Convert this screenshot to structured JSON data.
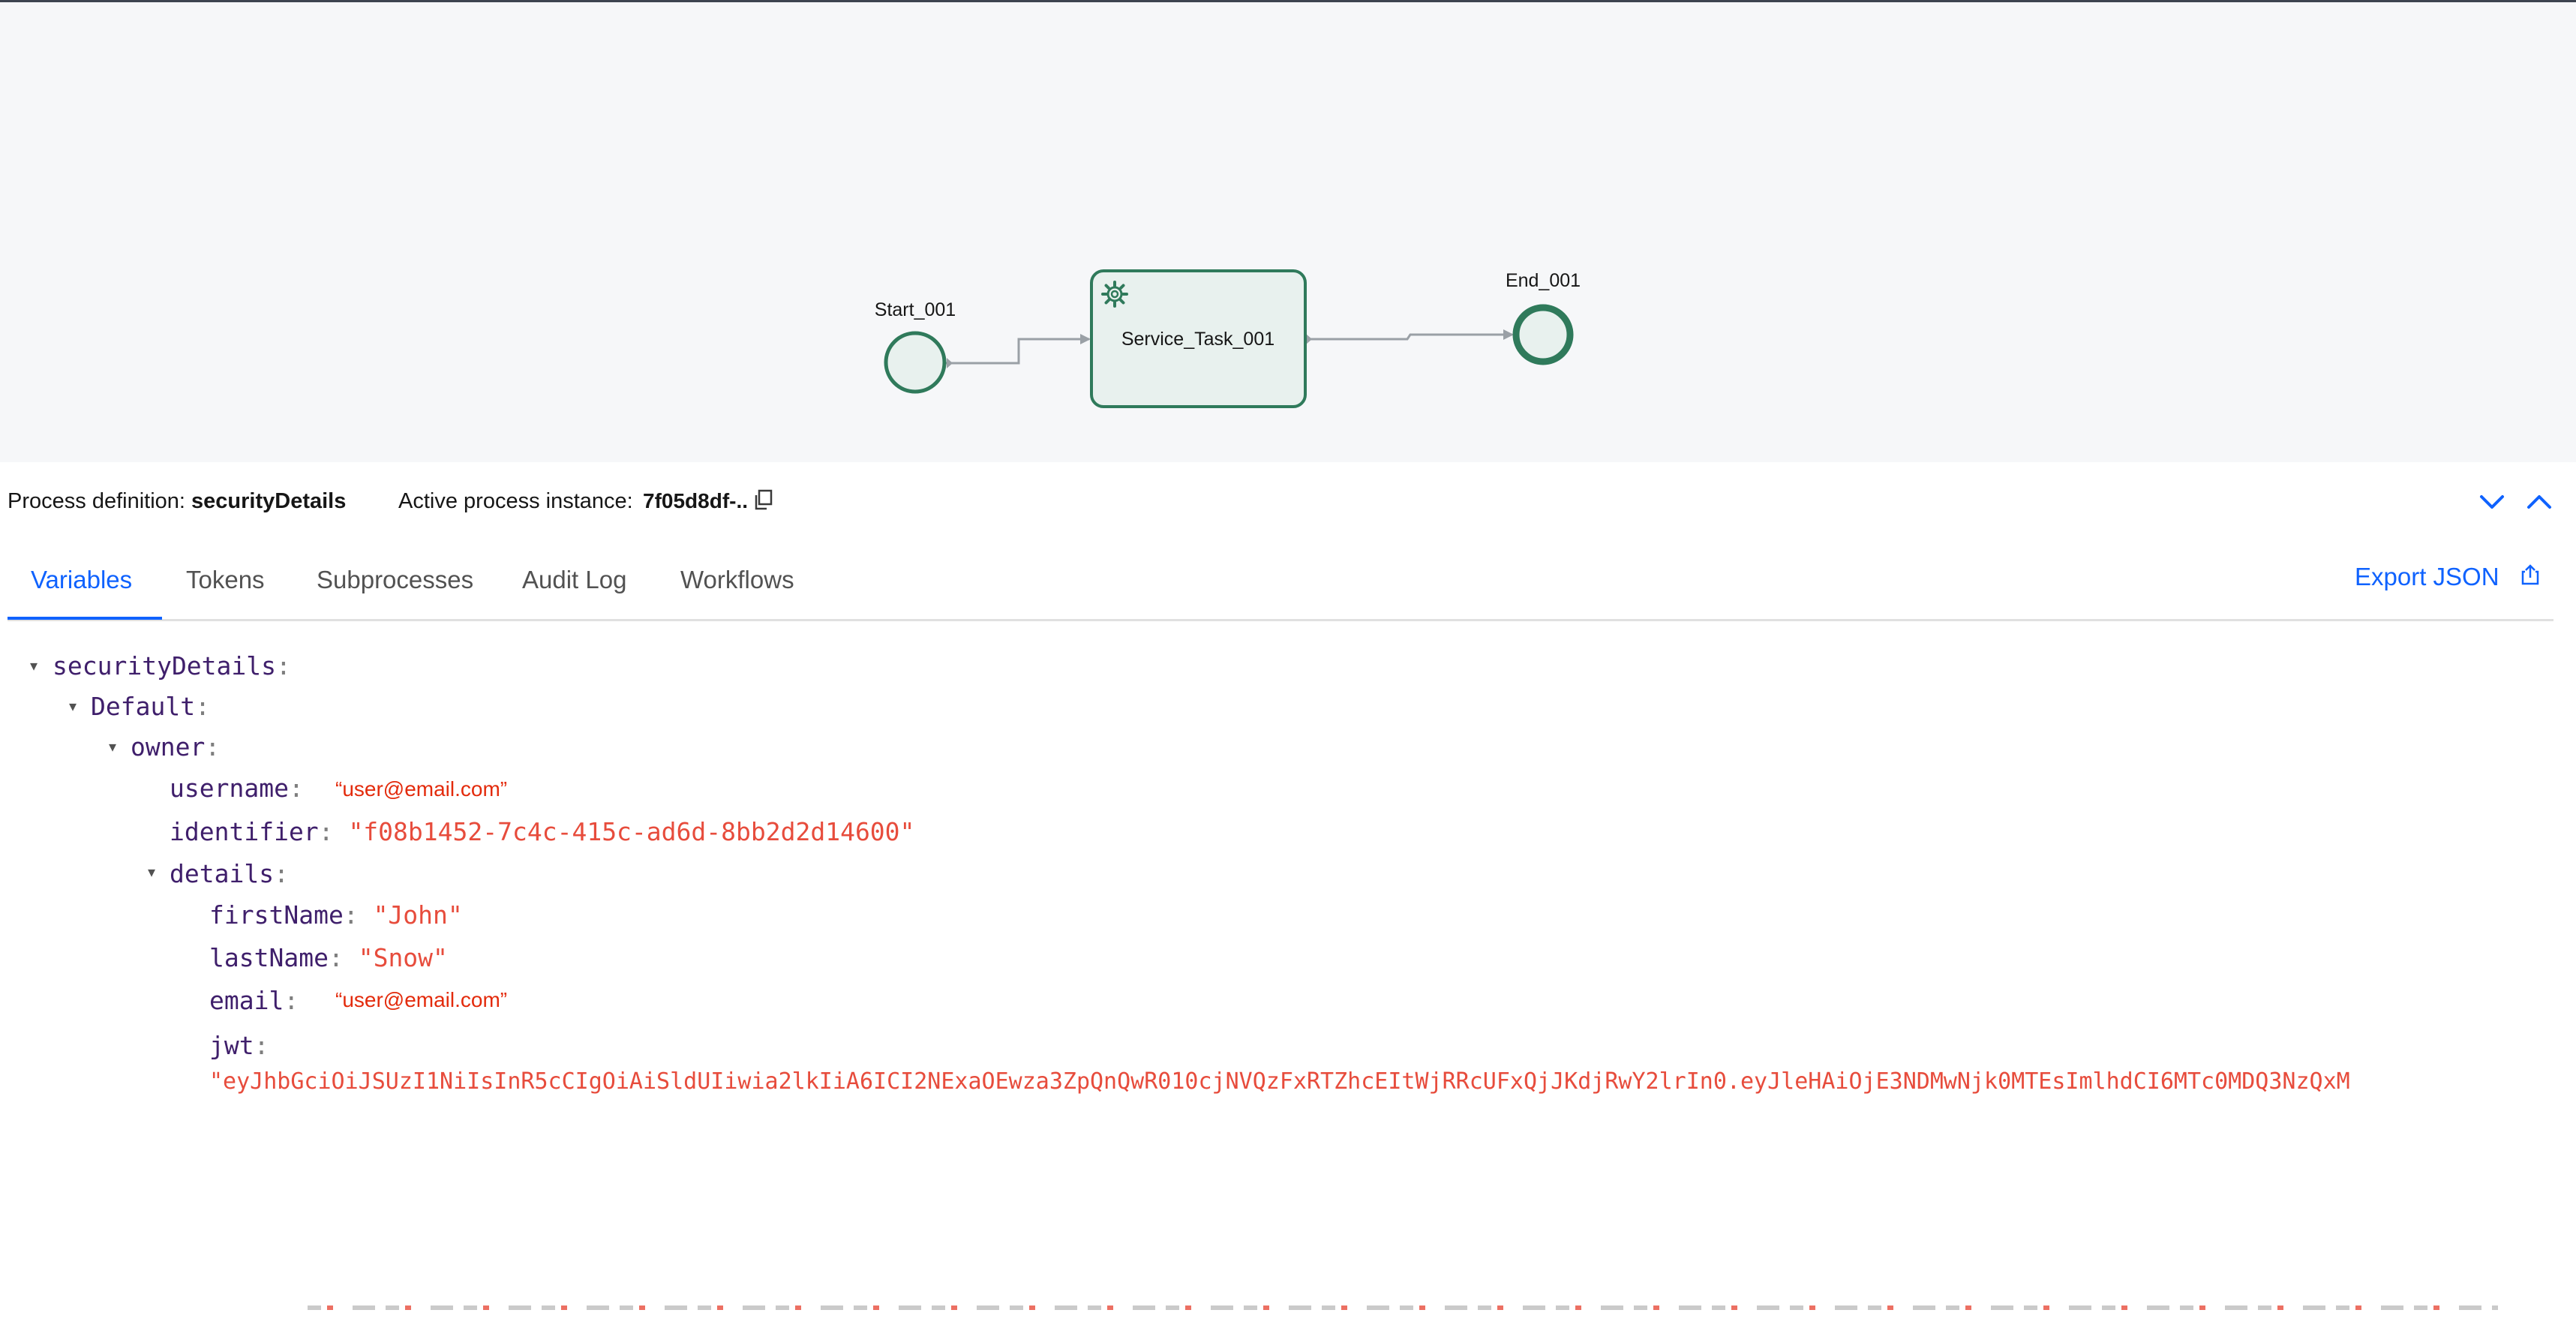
{
  "diagram": {
    "nodes": {
      "start": {
        "label": "Start_001",
        "type": "start-event"
      },
      "task": {
        "label": "Service_Task_001",
        "type": "service-task",
        "icon": "gear-icon"
      },
      "end": {
        "label": "End_001",
        "type": "end-event"
      }
    },
    "colors": {
      "node_stroke": "#2f7a5b",
      "task_fill": "#e8f1ee",
      "connector": "#9aa0a6",
      "canvas_bg": "#f6f7f9"
    }
  },
  "instance_bar": {
    "definition_prefix": "Process definition:",
    "definition_name": "securityDetails",
    "instance_prefix": "Active process instance:",
    "instance_id": "7f05d8df-..",
    "copy_icon": "copy-icon",
    "collapse_icon": "chevron-down-icon",
    "expand_icon": "chevron-up-icon"
  },
  "tabs": [
    {
      "label": "Variables",
      "active": true
    },
    {
      "label": "Tokens",
      "active": false
    },
    {
      "label": "Subprocesses",
      "active": false
    },
    {
      "label": "Audit Log",
      "active": false
    },
    {
      "label": "Workflows",
      "active": false
    }
  ],
  "export": {
    "label": "Export JSON",
    "icon": "share-icon"
  },
  "tree": {
    "root": "securityDetails",
    "default_key": "Default",
    "owner_key": "owner",
    "username_key": "username",
    "username_value": "“user@email.com”",
    "identifier_key": "identifier",
    "identifier_value": "\"f08b1452-7c4c-415c-ad6d-8bb2d2d14600\"",
    "details_key": "details",
    "firstname_key": "firstName",
    "firstname_value": "\"John\"",
    "lastname_key": "lastName",
    "lastname_value": "\"Snow\"",
    "email_key": "email",
    "email_value": "“user@email.com”",
    "jwt_key": "jwt",
    "jwt_value": "\"eyJhbGciOiJSUzI1NiIsInR5cCIgOiAiSldUIiwia2lkIiA6ICI2NExaOEwza3ZpQnQwR010cjNVQzFxRTZhcEItWjRRcUFxQjJKdjRwY2lrIn0.eyJleHAiOjE3NDMwNjk0MTEsImlhdCI6MTc0MDQ3NzQxM",
    "colon": ":"
  },
  "colors": {
    "accent": "#0f62fe",
    "key": "#3f1f6b",
    "string": "#e74c3c"
  }
}
